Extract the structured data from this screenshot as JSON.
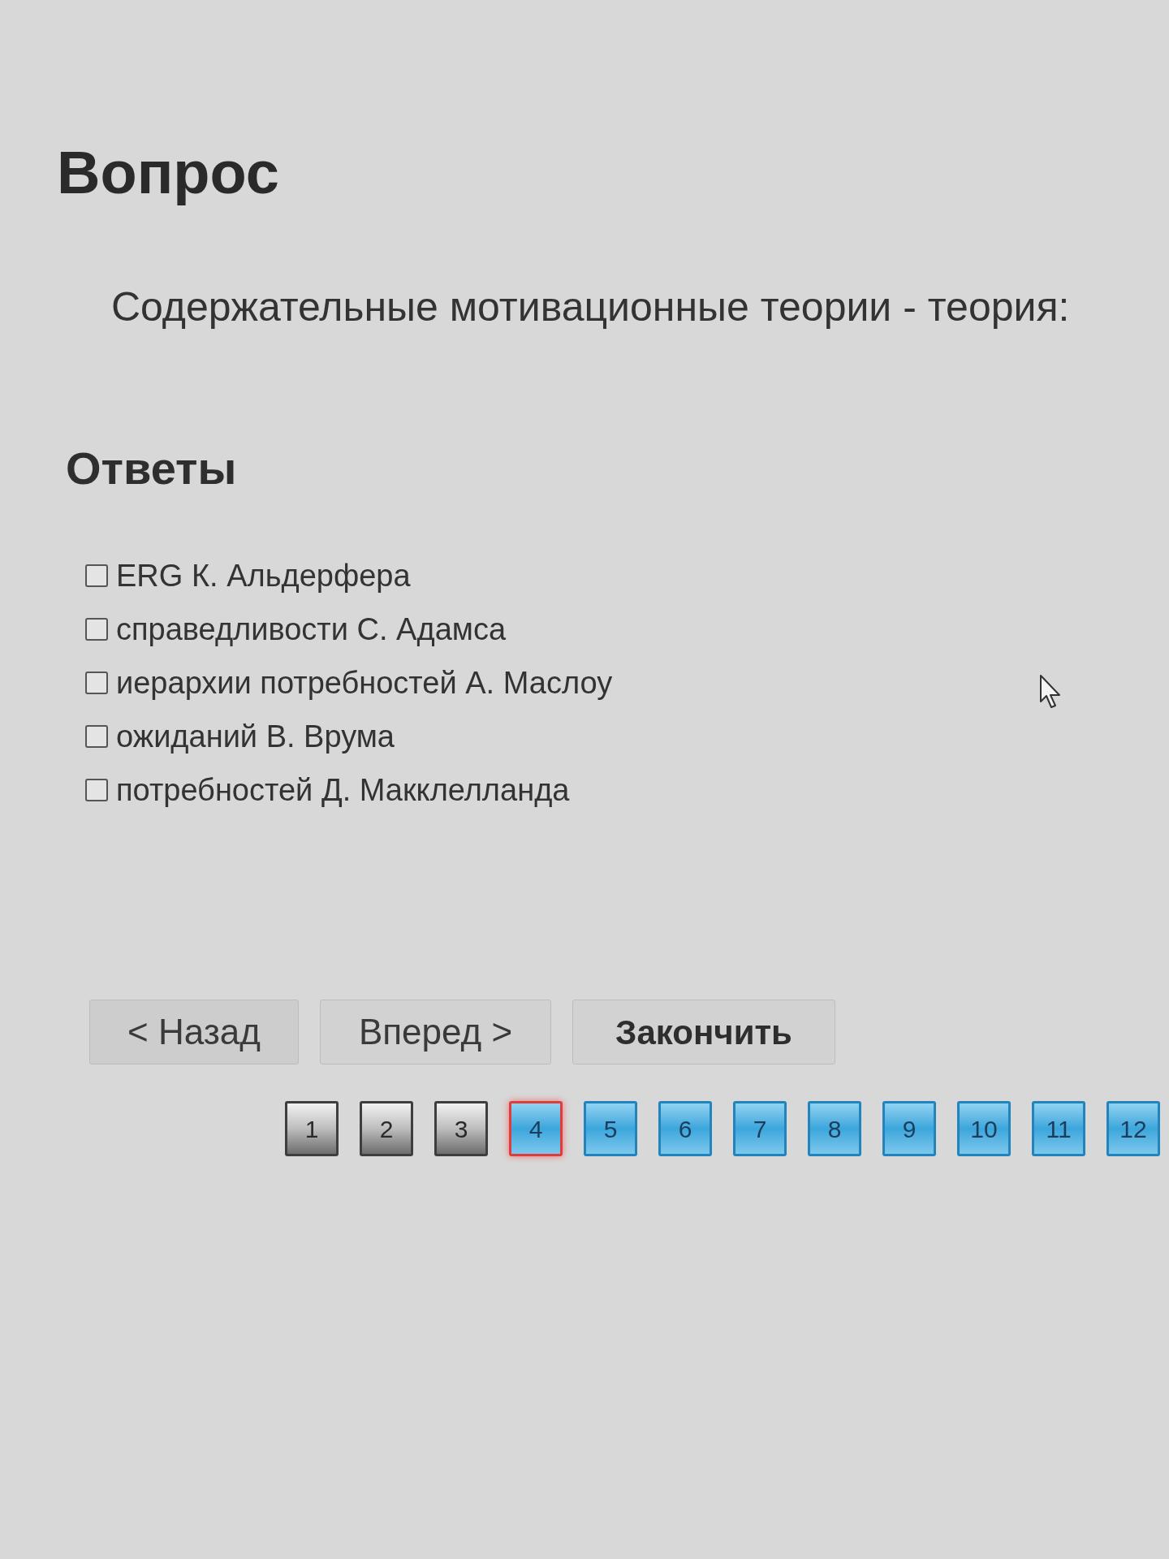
{
  "question_heading": "Вопрос",
  "question_text": "Содержательные мотивационные теории - теория:",
  "answers_heading": "Ответы",
  "answers": [
    {
      "label": "ERG К. Альдерфера",
      "checked": false
    },
    {
      "label": "справедливости С. Адамса",
      "checked": false
    },
    {
      "label": "иерархии потребностей А. Маслоу",
      "checked": false
    },
    {
      "label": "ожиданий В. Врума",
      "checked": false
    },
    {
      "label": "потребностей Д. Макклелланда",
      "checked": false
    }
  ],
  "buttons": [
    {
      "label": "< Назад",
      "kind": "back"
    },
    {
      "label": "Вперед >",
      "kind": "next"
    },
    {
      "label": "Закончить",
      "kind": "finish"
    }
  ],
  "pages": [
    {
      "label": "1",
      "visited": true,
      "selected": false
    },
    {
      "label": "2",
      "visited": true,
      "selected": false
    },
    {
      "label": "3",
      "visited": true,
      "selected": false
    },
    {
      "label": "4",
      "visited": false,
      "selected": true
    },
    {
      "label": "5",
      "visited": false,
      "selected": false
    },
    {
      "label": "6",
      "visited": false,
      "selected": false
    },
    {
      "label": "7",
      "visited": false,
      "selected": false
    },
    {
      "label": "8",
      "visited": false,
      "selected": false
    },
    {
      "label": "9",
      "visited": false,
      "selected": false
    },
    {
      "label": "10",
      "visited": false,
      "selected": false
    },
    {
      "label": "11",
      "visited": false,
      "selected": false
    },
    {
      "label": "12",
      "visited": false,
      "selected": false
    }
  ]
}
